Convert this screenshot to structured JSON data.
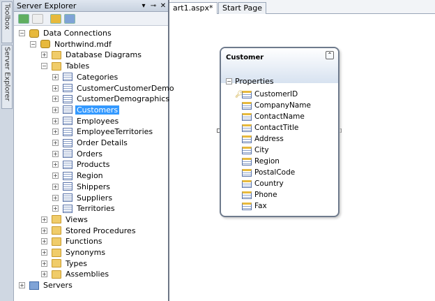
{
  "sidebar_tabs": [
    "Toolbox",
    "Server Explorer"
  ],
  "panel": {
    "title": "Server Explorer",
    "buttons": [
      "dropdown",
      "pin",
      "close"
    ]
  },
  "toolbar": [
    "refresh",
    "stop",
    "connect-to-database",
    "connect-to-server"
  ],
  "tree": [
    {
      "label": "Data Connections",
      "level": 0,
      "icon": "db",
      "exp": "-"
    },
    {
      "label": "Northwind.mdf",
      "level": 1,
      "icon": "db",
      "exp": "-"
    },
    {
      "label": "Database Diagrams",
      "level": 2,
      "icon": "folder",
      "exp": "+"
    },
    {
      "label": "Tables",
      "level": 2,
      "icon": "folder",
      "exp": "-"
    },
    {
      "label": "Categories",
      "level": 3,
      "icon": "table",
      "exp": "+"
    },
    {
      "label": "CustomerCustomerDemo",
      "level": 3,
      "icon": "table",
      "exp": "+"
    },
    {
      "label": "CustomerDemographics",
      "level": 3,
      "icon": "table",
      "exp": "+"
    },
    {
      "label": "Customers",
      "level": 3,
      "icon": "table",
      "exp": "+",
      "selected": true
    },
    {
      "label": "Employees",
      "level": 3,
      "icon": "table",
      "exp": "+"
    },
    {
      "label": "EmployeeTerritories",
      "level": 3,
      "icon": "table",
      "exp": "+"
    },
    {
      "label": "Order Details",
      "level": 3,
      "icon": "table",
      "exp": "+"
    },
    {
      "label": "Orders",
      "level": 3,
      "icon": "table",
      "exp": "+"
    },
    {
      "label": "Products",
      "level": 3,
      "icon": "table",
      "exp": "+"
    },
    {
      "label": "Region",
      "level": 3,
      "icon": "table",
      "exp": "+"
    },
    {
      "label": "Shippers",
      "level": 3,
      "icon": "table",
      "exp": "+"
    },
    {
      "label": "Suppliers",
      "level": 3,
      "icon": "table",
      "exp": "+"
    },
    {
      "label": "Territories",
      "level": 3,
      "icon": "table",
      "exp": "+"
    },
    {
      "label": "Views",
      "level": 2,
      "icon": "folder",
      "exp": "+"
    },
    {
      "label": "Stored Procedures",
      "level": 2,
      "icon": "folder",
      "exp": "+"
    },
    {
      "label": "Functions",
      "level": 2,
      "icon": "folder",
      "exp": "+"
    },
    {
      "label": "Synonyms",
      "level": 2,
      "icon": "folder",
      "exp": "+"
    },
    {
      "label": "Types",
      "level": 2,
      "icon": "folder",
      "exp": "+"
    },
    {
      "label": "Assemblies",
      "level": 2,
      "icon": "folder",
      "exp": "+"
    },
    {
      "label": "Servers",
      "level": 0,
      "icon": "srv",
      "exp": "+"
    }
  ],
  "doc_tabs": [
    "art1.aspx*",
    "Start Page"
  ],
  "entity": {
    "title": "Customer",
    "section": "Properties",
    "key": "CustomerID",
    "properties": [
      "CustomerID",
      "CompanyName",
      "ContactName",
      "ContactTitle",
      "Address",
      "City",
      "Region",
      "PostalCode",
      "Country",
      "Phone",
      "Fax"
    ]
  }
}
